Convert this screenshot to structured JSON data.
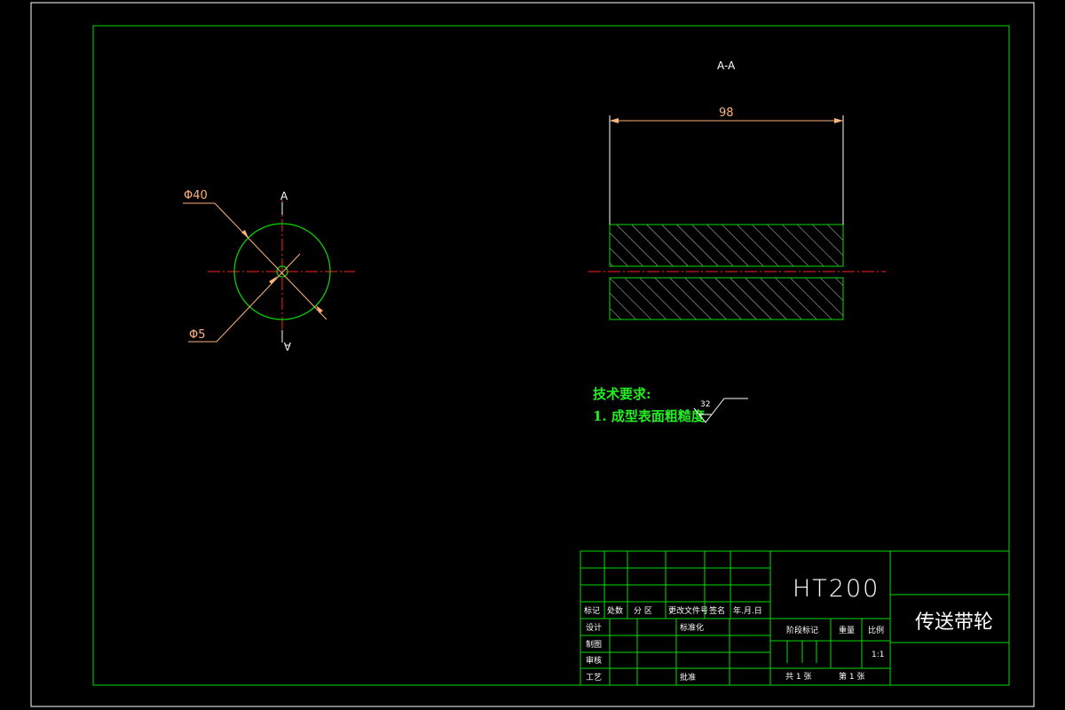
{
  "drawing": {
    "section_title": "A-A",
    "section_marker_top": "A",
    "section_marker_bottom": "A",
    "dim_outer_diameter": "Φ40",
    "dim_bore_diameter": "Φ5",
    "dim_length": "98"
  },
  "notes": {
    "heading": "技术要求:",
    "item1": "1. 成型表面粗糙度",
    "roughness_value": "32"
  },
  "title_block": {
    "material": "HT200",
    "part_name": "传送带轮",
    "row_labels": [
      "标记",
      "处数",
      "分 区",
      "更改文件号",
      "签名",
      "年.月.日"
    ],
    "design": "设计",
    "standardize": "标准化",
    "drafting": "制图",
    "review": "审核",
    "process": "工艺",
    "approve": "批准",
    "stage_mark": "阶段标记",
    "weight": "重量",
    "scale": "比例",
    "scale_value": "1:1",
    "total_sheets": "共  1  张",
    "sheet_number": "第  1  张"
  },
  "colors": {
    "frame": "#00dd00",
    "dimension": "#ffb27a",
    "centerline": "#ff2020",
    "text": "#ffffff"
  }
}
